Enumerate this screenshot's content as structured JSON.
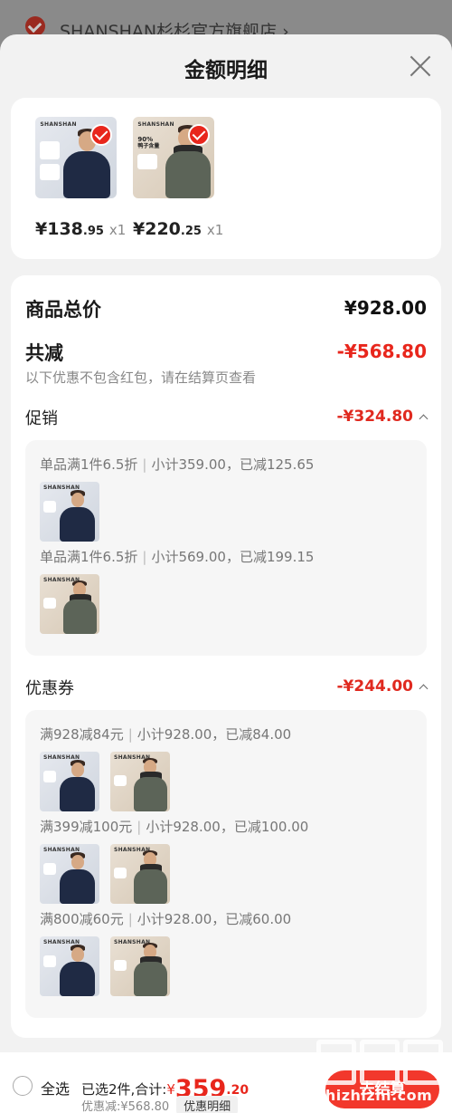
{
  "store": {
    "name": "SHANSHAN杉杉官方旗舰店 ›"
  },
  "sheet": {
    "title": "金额明细"
  },
  "items": [
    {
      "brand": "SHANSHAN",
      "price_int": "¥138",
      "price_dec": ".95",
      "qty": "x1"
    },
    {
      "brand": "SHANSHAN",
      "price_int": "¥220",
      "price_dec": ".25",
      "qty": "x1",
      "badge": "90%",
      "badge_sub": "鸭子含量"
    }
  ],
  "summary": {
    "total_label": "商品总价",
    "total_value": "¥928.00",
    "reduce_label": "共减",
    "reduce_value": "-¥568.80",
    "note": "以下优惠不包含红包，请在结算页查看"
  },
  "promotion": {
    "label": "促销",
    "value": "-¥324.80",
    "lines": [
      {
        "rule": "单品满1件6.5折",
        "detail": "小计359.00，已减125.65"
      },
      {
        "rule": "单品满1件6.5折",
        "detail": "小计569.00，已减199.15"
      }
    ]
  },
  "coupon": {
    "label": "优惠券",
    "value": "-¥244.00",
    "lines": [
      {
        "rule": "满928减84元",
        "detail": "小计928.00，已减84.00"
      },
      {
        "rule": "满399减100元",
        "detail": "小计928.00，已减100.00"
      },
      {
        "rule": "满800减60元",
        "detail": "小计928.00，已减60.00"
      }
    ]
  },
  "bottom": {
    "select_all": "全选",
    "selected_text": "已选2件,合计:",
    "yen": "¥",
    "total_int": "359",
    "total_dec": ".20",
    "discount_text": "优惠减:¥568.80",
    "detail_chip": "优惠明细",
    "checkout": "去结算"
  },
  "watermark": {
    "text": "zhizhizhi.com"
  },
  "colors": {
    "accent": "#e8261c",
    "price_red": "#e0291f",
    "background": "#f2f2f2"
  }
}
